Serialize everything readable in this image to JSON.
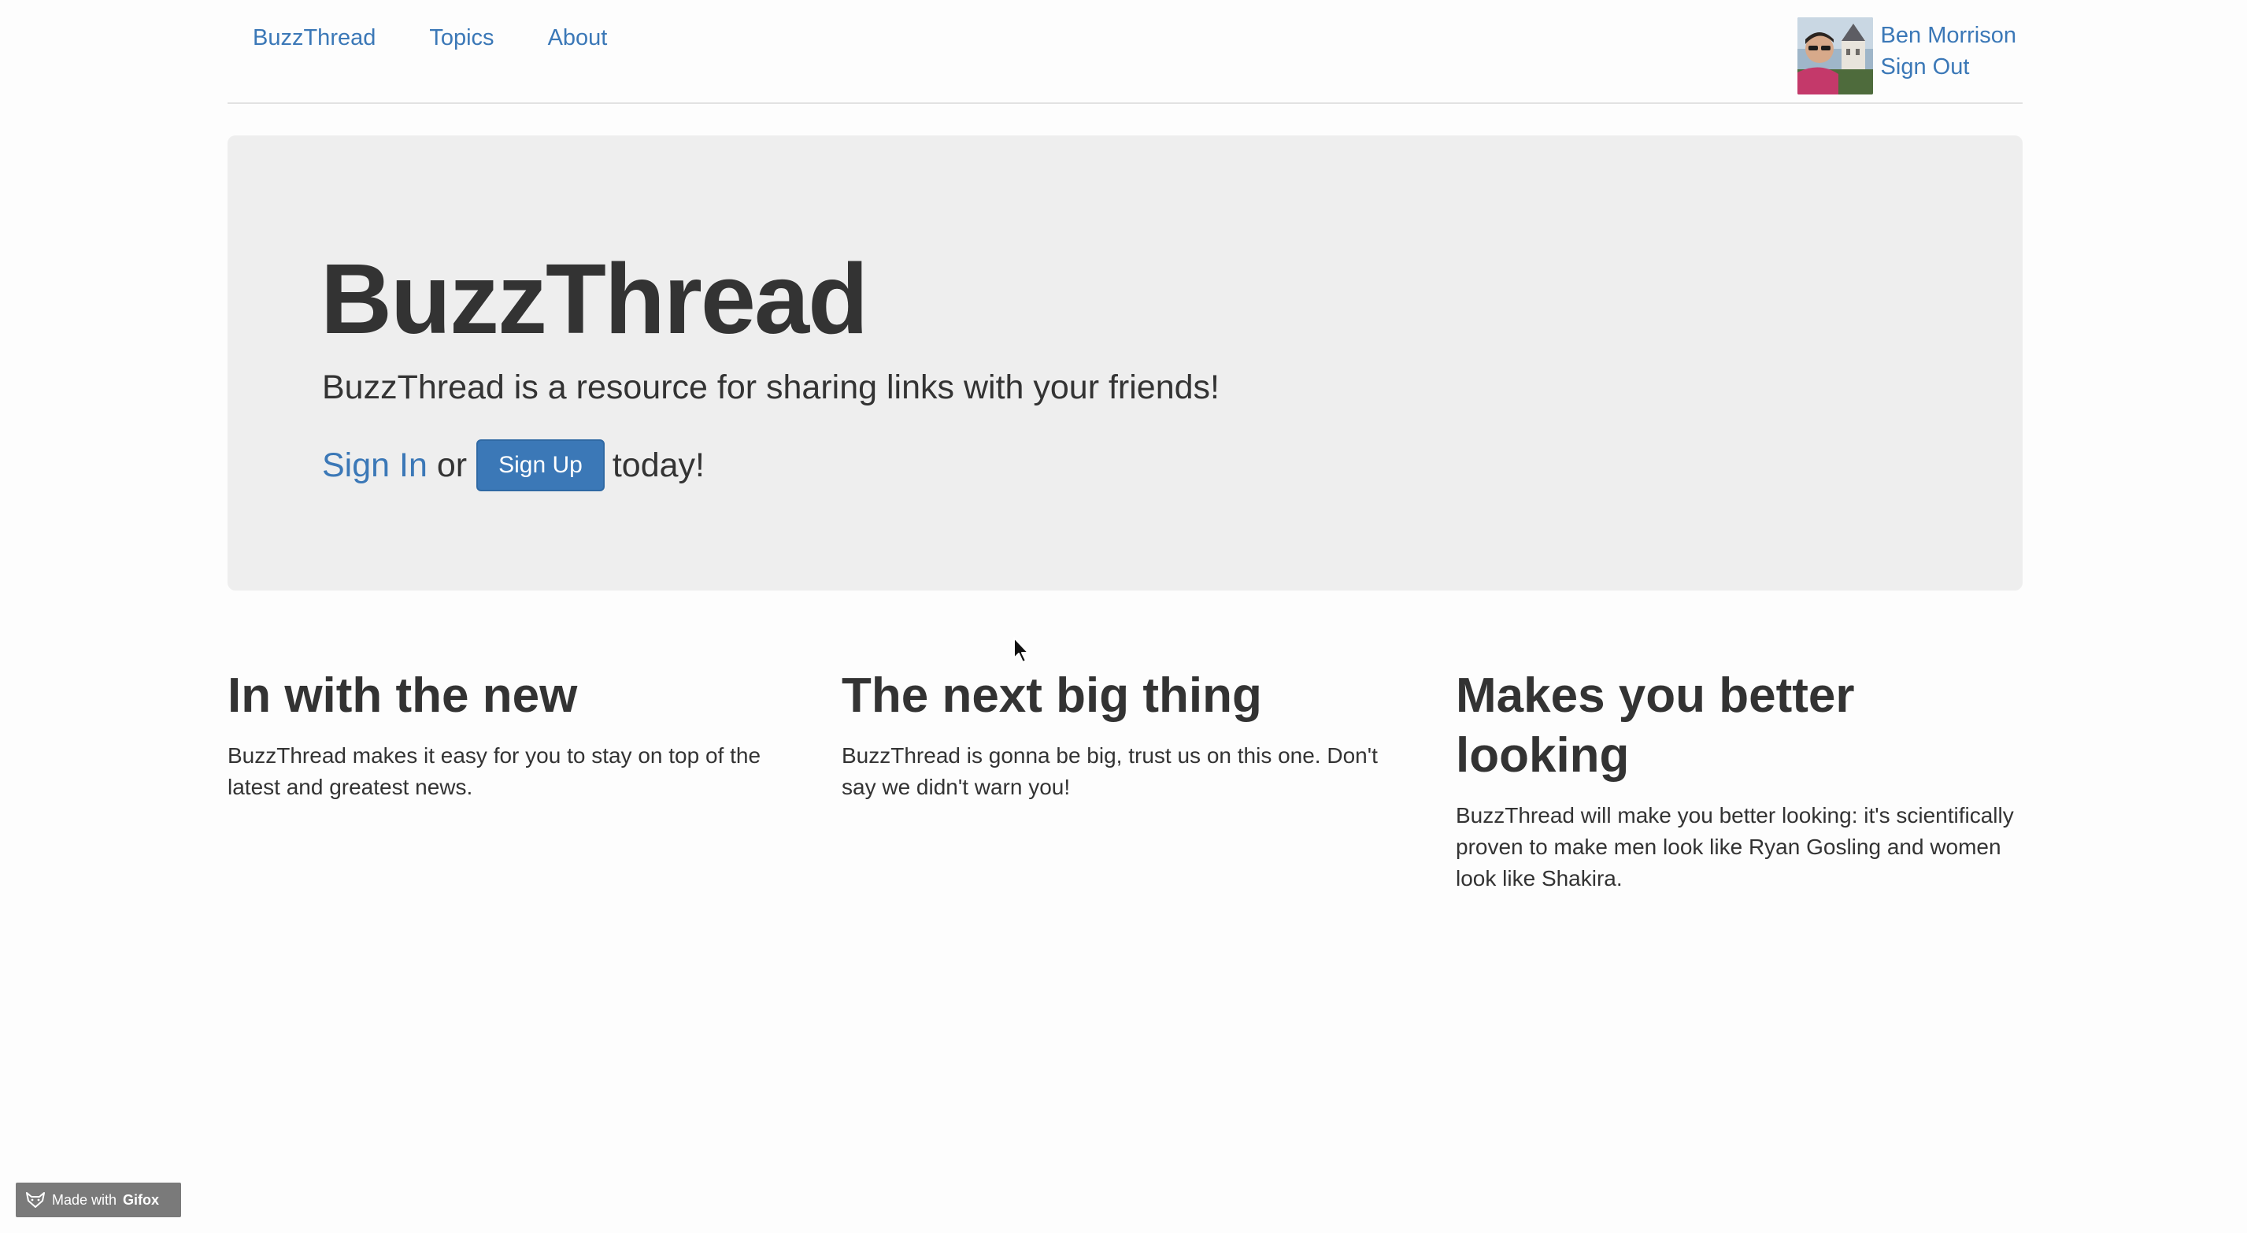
{
  "nav": {
    "links": [
      "BuzzThread",
      "Topics",
      "About"
    ],
    "user": {
      "name": "Ben Morrison",
      "sign_out": "Sign Out"
    }
  },
  "hero": {
    "title": "BuzzThread",
    "lead": "BuzzThread is a resource for sharing links with your friends!",
    "sign_in": "Sign In",
    "or": "or",
    "sign_up": "Sign Up",
    "today": "today!"
  },
  "features": [
    {
      "heading": "In with the new",
      "body": "BuzzThread makes it easy for you to stay on top of the latest and greatest news."
    },
    {
      "heading": "The next big thing",
      "body": "BuzzThread is gonna be big, trust us on this one. Don't say we didn't warn you!"
    },
    {
      "heading": "Makes you better looking",
      "body": "BuzzThread will make you better looking: it's scientifically proven to make men look like Ryan Gosling and women look like Shakira."
    }
  ],
  "badge": {
    "made_with": "Made with",
    "brand": "Gifox"
  },
  "icons": {
    "avatar": "user-avatar-photo",
    "badge": "gifox-fox-icon",
    "cursor": "mouse-pointer-icon"
  },
  "colors": {
    "link": "#3b78b7",
    "jumbotron_bg": "#eeeeee",
    "text": "#333333",
    "button_primary": "#3b78b7"
  }
}
